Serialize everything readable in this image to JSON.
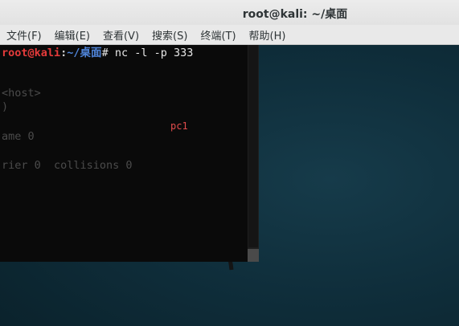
{
  "window": {
    "title": "root@kali: ~/桌面"
  },
  "menu": {
    "items": [
      "文件(F)",
      "编辑(E)",
      "查看(V)",
      "搜索(S)",
      "终端(T)",
      "帮助(H)"
    ]
  },
  "terminal": {
    "prompt_user": "root@kali",
    "prompt_colon": ":",
    "prompt_path": "~/桌面",
    "prompt_symbol": "# ",
    "command": "nc -l -p 333",
    "line_host": "<host>",
    "line_paren": ")",
    "line_pc1": "pc1",
    "line_frame": "ame 0",
    "line_carrier": "rier 0  collisions 0"
  },
  "colors": {
    "prompt_user": "#e53b3b",
    "prompt_path": "#4f84d8",
    "terminal_bg": "#0a0a0a",
    "desktop_bg": "#0f2e3b"
  }
}
